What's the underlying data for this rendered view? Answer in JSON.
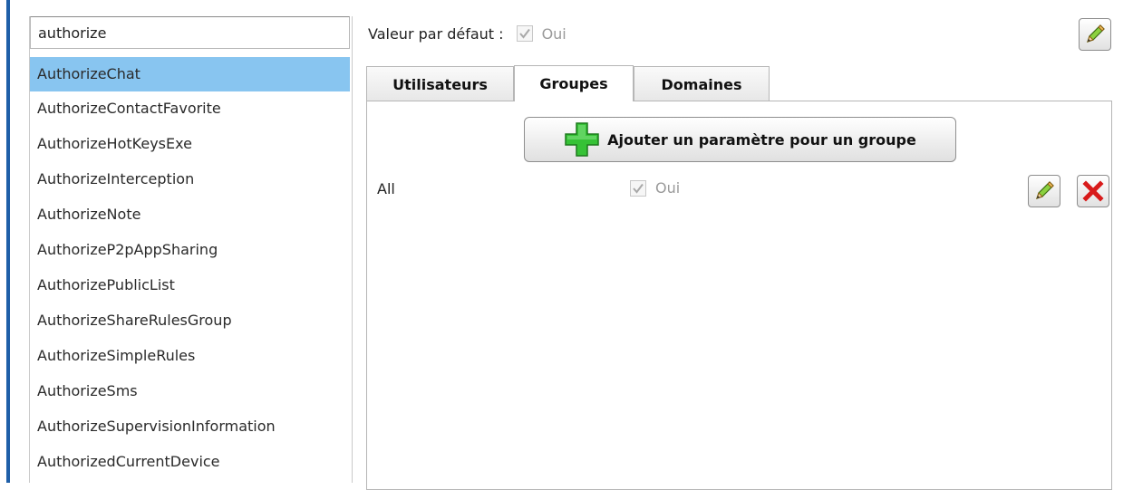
{
  "search": {
    "value": "authorize"
  },
  "list": {
    "selected_index": 0,
    "items": [
      "AuthorizeChat",
      "AuthorizeContactFavorite",
      "AuthorizeHotKeysExe",
      "AuthorizeInterception",
      "AuthorizeNote",
      "AuthorizeP2pAppSharing",
      "AuthorizePublicList",
      "AuthorizeShareRulesGroup",
      "AuthorizeSimpleRules",
      "AuthorizeSms",
      "AuthorizeSupervisionInformation",
      "AuthorizedCurrentDevice"
    ]
  },
  "default_value": {
    "label": "Valeur par défaut :",
    "checked": true,
    "value_text": "Oui"
  },
  "tabs": [
    {
      "label": "Utilisateurs",
      "active": false
    },
    {
      "label": "Groupes",
      "active": true
    },
    {
      "label": "Domaines",
      "active": false
    }
  ],
  "add_button": {
    "label": "Ajouter un paramètre pour un groupe"
  },
  "rows": [
    {
      "name": "All",
      "checked": true,
      "value_text": "Oui"
    }
  ],
  "icons": {
    "edit": "pencil-icon",
    "delete": "delete-x-icon",
    "add": "plus-icon",
    "check": "checkmark-icon"
  },
  "colors": {
    "selected_row": "#88c5f0",
    "left_rule": "#1f5fa8",
    "add_green": "#2fb82f",
    "delete_red": "#d81a1a"
  }
}
